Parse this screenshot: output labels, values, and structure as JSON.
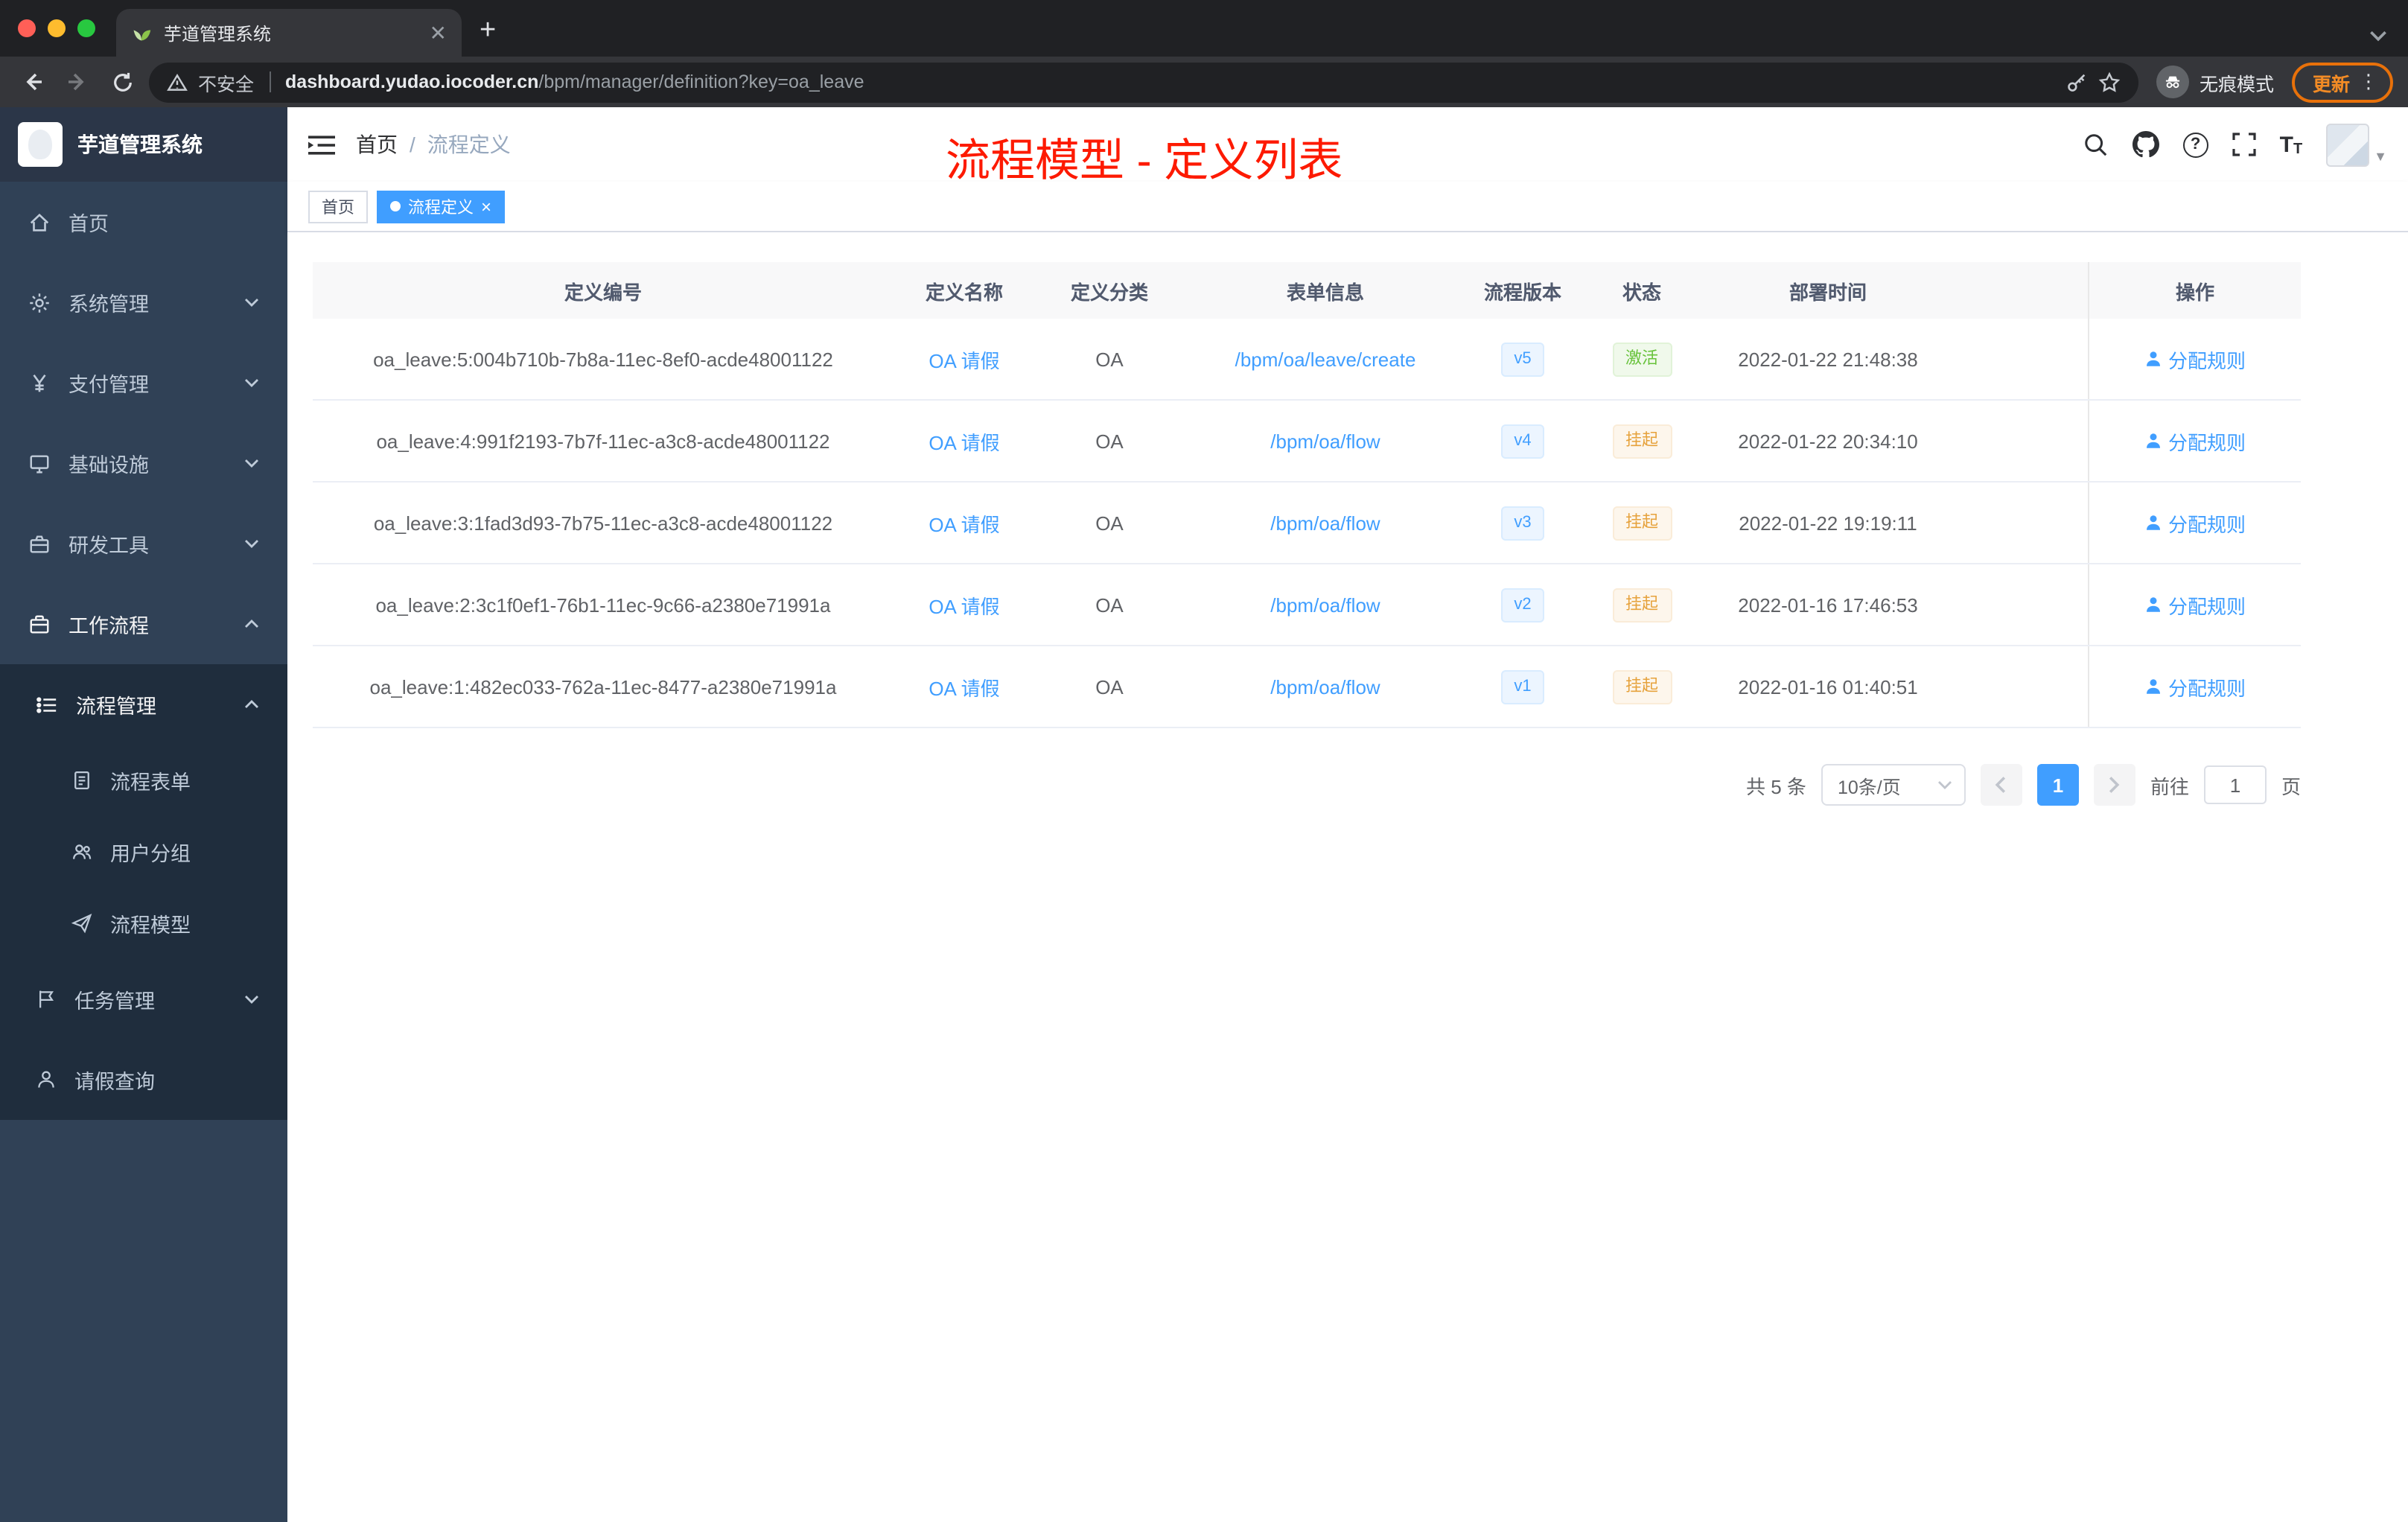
{
  "browser": {
    "tab_title": "芋道管理系统",
    "security_label": "不安全",
    "url_host": "dashboard.yudao.iocoder.cn",
    "url_path": "/bpm/manager/definition?key=oa_leave",
    "incognito_label": "无痕模式",
    "update_label": "更新"
  },
  "sidebar": {
    "brand": "芋道管理系统",
    "items": [
      {
        "label": "首页"
      },
      {
        "label": "系统管理"
      },
      {
        "label": "支付管理"
      },
      {
        "label": "基础设施"
      },
      {
        "label": "研发工具"
      },
      {
        "label": "工作流程"
      },
      {
        "label": "流程管理"
      },
      {
        "label": "流程表单"
      },
      {
        "label": "用户分组"
      },
      {
        "label": "流程模型"
      },
      {
        "label": "任务管理"
      },
      {
        "label": "请假查询"
      }
    ]
  },
  "header": {
    "breadcrumb_home": "首页",
    "breadcrumb_sep": "/",
    "breadcrumb_current": "流程定义",
    "annotation": "流程模型 - 定义列表"
  },
  "tags": {
    "home": "首页",
    "current": "流程定义"
  },
  "table": {
    "columns": [
      "定义编号",
      "定义名称",
      "定义分类",
      "表单信息",
      "流程版本",
      "状态",
      "部署时间",
      "操作"
    ],
    "rows": [
      {
        "id": "oa_leave:5:004b710b-7b8a-11ec-8ef0-acde48001122",
        "name": "OA 请假",
        "category": "OA",
        "form": "/bpm/oa/leave/create",
        "version": "v5",
        "status": "激活",
        "time": "2022-01-22 21:48:38",
        "action": "分配规则"
      },
      {
        "id": "oa_leave:4:991f2193-7b7f-11ec-a3c8-acde48001122",
        "name": "OA 请假",
        "category": "OA",
        "form": "/bpm/oa/flow",
        "version": "v4",
        "status": "挂起",
        "time": "2022-01-22 20:34:10",
        "action": "分配规则"
      },
      {
        "id": "oa_leave:3:1fad3d93-7b75-11ec-a3c8-acde48001122",
        "name": "OA 请假",
        "category": "OA",
        "form": "/bpm/oa/flow",
        "version": "v3",
        "status": "挂起",
        "time": "2022-01-22 19:19:11",
        "action": "分配规则"
      },
      {
        "id": "oa_leave:2:3c1f0ef1-76b1-11ec-9c66-a2380e71991a",
        "name": "OA 请假",
        "category": "OA",
        "form": "/bpm/oa/flow",
        "version": "v2",
        "status": "挂起",
        "time": "2022-01-16 17:46:53",
        "action": "分配规则"
      },
      {
        "id": "oa_leave:1:482ec033-762a-11ec-8477-a2380e71991a",
        "name": "OA 请假",
        "category": "OA",
        "form": "/bpm/oa/flow",
        "version": "v1",
        "status": "挂起",
        "time": "2022-01-16 01:40:51",
        "action": "分配规则"
      }
    ]
  },
  "pagination": {
    "total": "共 5 条",
    "page_size": "10条/页",
    "page": "1",
    "goto": "前往",
    "goto_value": "1",
    "unit": "页"
  },
  "colors": {
    "accent": "#409eff",
    "success": "#67c23a",
    "warning": "#e6a23c",
    "annotation": "#fd1a00",
    "sidebar": "#304156",
    "submenu": "#1f2d3d"
  }
}
